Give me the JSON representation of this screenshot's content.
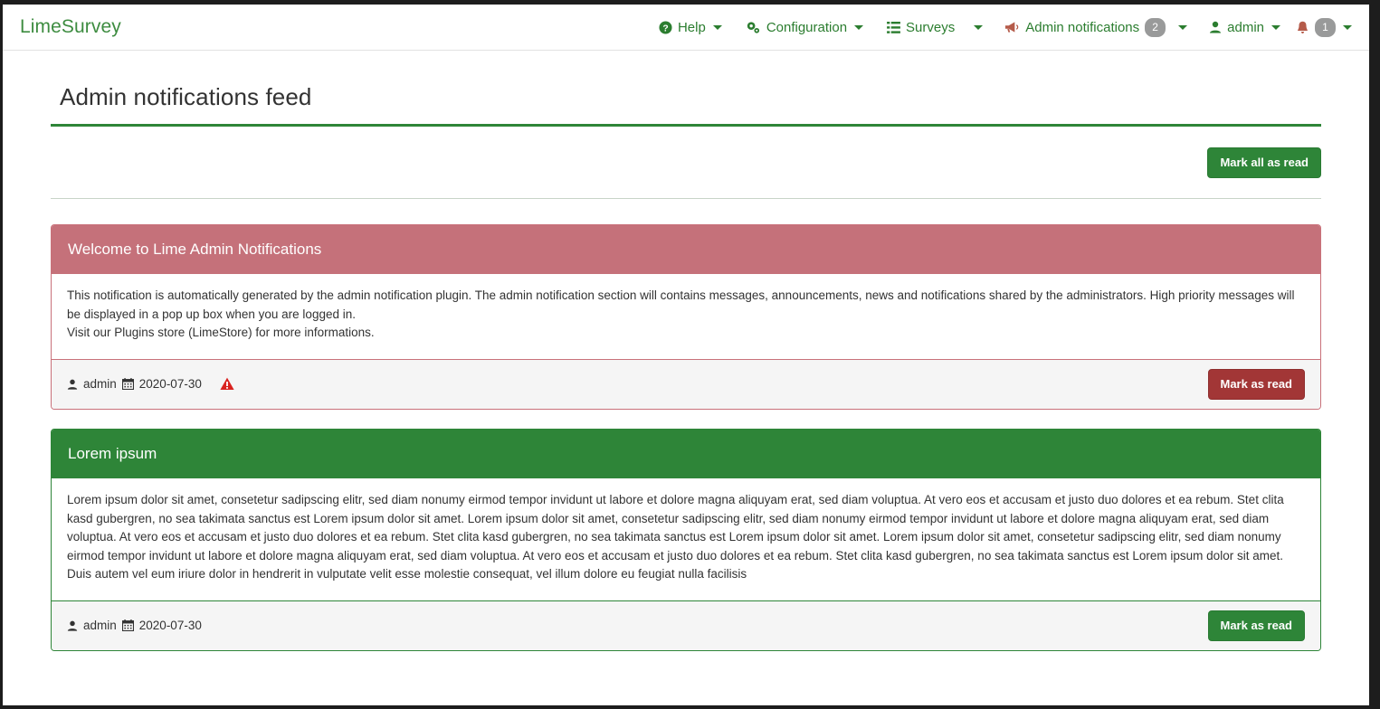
{
  "navbar": {
    "brand": "LimeSurvey",
    "items": [
      {
        "label": "Help",
        "icon": "help-circle-icon",
        "caret": true
      },
      {
        "label": "Configuration",
        "icon": "gear-icon",
        "caret": true
      },
      {
        "label": "Surveys",
        "icon": "list-icon",
        "caret": true
      },
      {
        "label": "Admin notifications",
        "icon": "megaphone-icon",
        "badge": "2",
        "caret": true
      },
      {
        "label": "admin",
        "icon": "user-icon",
        "caret": true
      },
      {
        "label": "",
        "icon": "bell-icon",
        "badge": "1",
        "caret": true
      }
    ]
  },
  "page": {
    "title": "Admin notifications feed",
    "mark_all_as_read_label": "Mark all as read"
  },
  "notifications": [
    {
      "title": "Welcome to Lime Admin Notifications",
      "body_lines": [
        "This notification is automatically generated by the admin notification plugin. The admin notification section will contains messages, announcements, news and notifications shared by the administrators. High priority messages will be displayed in a pop up box when you are logged in.",
        "Visit our Plugins store (LimeStore) for more informations."
      ],
      "author": "admin",
      "date": "2020-07-30",
      "priority_icon": "warning-triangle-icon",
      "button_label": "Mark as read",
      "style": "danger",
      "header_color": "#c5717a",
      "button_color": "#a23636"
    },
    {
      "title": "Lorem ipsum",
      "body_lines": [
        "Lorem ipsum dolor sit amet, consetetur sadipscing elitr, sed diam nonumy eirmod tempor invidunt ut labore et dolore magna aliquyam erat, sed diam voluptua. At vero eos et accusam et justo duo dolores et ea rebum. Stet clita kasd gubergren, no sea takimata sanctus est Lorem ipsum dolor sit amet. Lorem ipsum dolor sit amet, consetetur sadipscing elitr, sed diam nonumy eirmod tempor invidunt ut labore et dolore magna aliquyam erat, sed diam voluptua. At vero eos et accusam et justo duo dolores et ea rebum. Stet clita kasd gubergren, no sea takimata sanctus est Lorem ipsum dolor sit amet. Lorem ipsum dolor sit amet, consetetur sadipscing elitr, sed diam nonumy eirmod tempor invidunt ut labore et dolore magna aliquyam erat, sed diam voluptua. At vero eos et accusam et justo duo dolores et ea rebum. Stet clita kasd gubergren, no sea takimata sanctus est Lorem ipsum dolor sit amet. Duis autem vel eum iriure dolor in hendrerit in vulputate velit esse molestie consequat, vel illum dolore eu feugiat nulla facilisis"
      ],
      "author": "admin",
      "date": "2020-07-30",
      "priority_icon": null,
      "button_label": "Mark as read",
      "style": "success",
      "header_color": "#2e8538",
      "button_color": "#2e8538"
    }
  ],
  "colors": {
    "brand_green": "#3d8c40",
    "accent_green": "#2e8538",
    "danger_red": "#c5717a",
    "danger_button": "#a23636",
    "badge_grey": "#999a9a",
    "warning_red": "#d9221f"
  }
}
